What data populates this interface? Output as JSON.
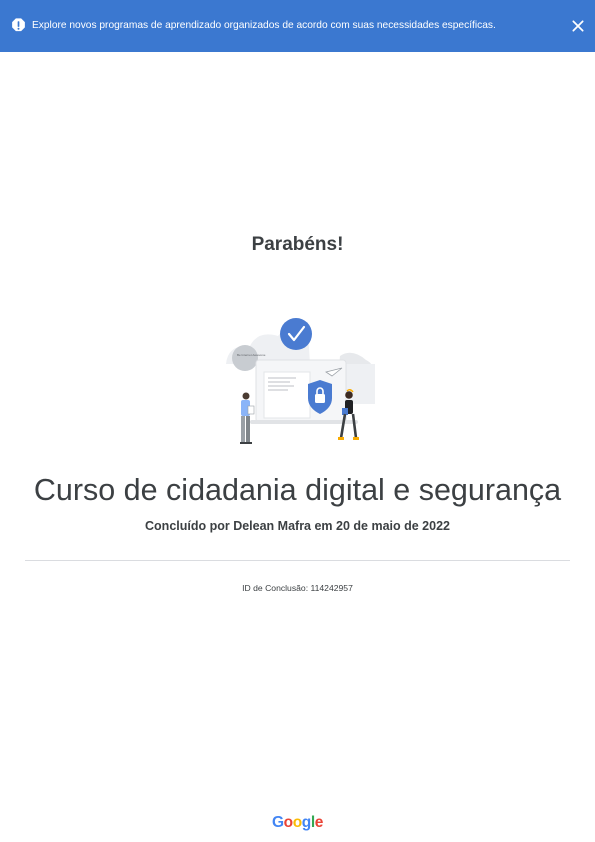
{
  "banner": {
    "icon": "alert-icon",
    "message": "Explore novos programas de aprendizado organizados de acordo com suas necessidades específicas.",
    "close_icon": "close-icon",
    "background": "#3b78d0"
  },
  "certificate": {
    "heading": "Parabéns!",
    "illustration_icon": "security-illustration",
    "illustration_badge_text": "Be Internet Awesome",
    "course_title": "Curso de cidadania digital e segurança",
    "completed_by": "Concluído por Delean Mafra em 20 de maio de 2022",
    "completion_id": "ID de Conclusão: 114242957"
  },
  "footer": {
    "logo_letters": [
      "G",
      "o",
      "o",
      "g",
      "l",
      "e"
    ],
    "logo_colors": [
      "#4285f4",
      "#ea4335",
      "#fbbc05",
      "#4285f4",
      "#34a853",
      "#ea4335"
    ]
  }
}
